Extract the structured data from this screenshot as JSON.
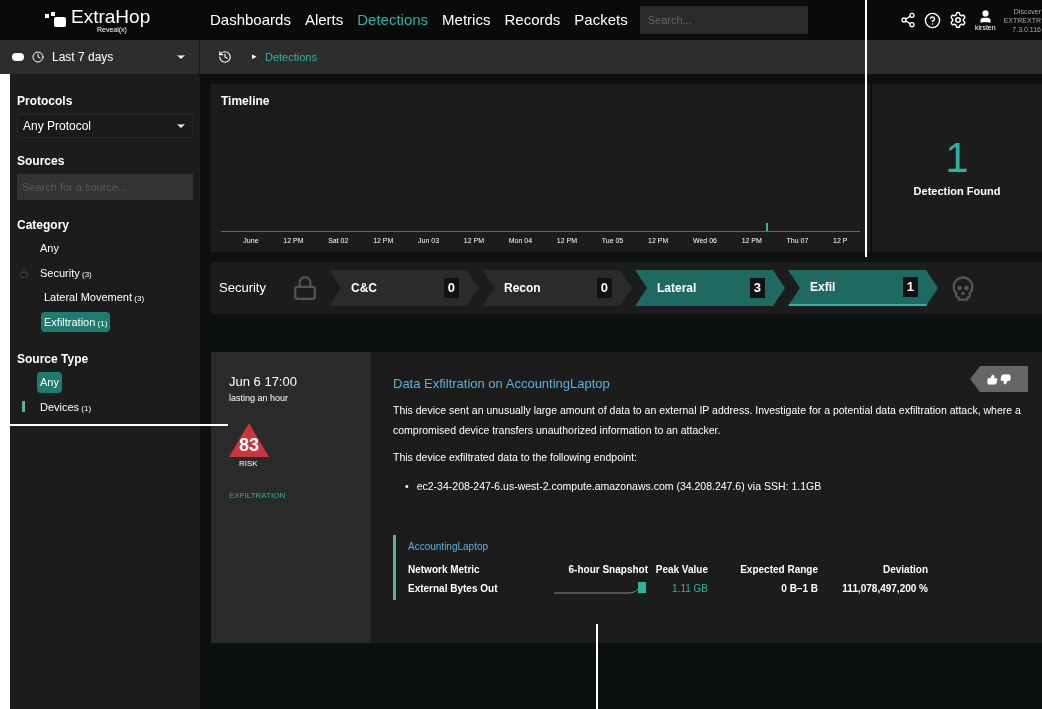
{
  "header": {
    "logo": {
      "name": "ExtraHop",
      "product": "Reveal(x)"
    },
    "nav": [
      {
        "label": "Dashboards",
        "selected": false
      },
      {
        "label": "Alerts",
        "selected": false
      },
      {
        "label": "Detections",
        "selected": true
      },
      {
        "label": "Metrics",
        "selected": false
      },
      {
        "label": "Records",
        "selected": false
      },
      {
        "label": "Packets",
        "selected": false
      }
    ],
    "search": {
      "placeholder": "Search..."
    },
    "user": "kirsten",
    "system": [
      "Discover",
      "EXTREXTR",
      "7.3.0.116"
    ]
  },
  "toolbar": {
    "time_range": "Last 7 days",
    "breadcrumb_arrow": "▸",
    "breadcrumb": "Detections"
  },
  "sidebar": {
    "protocols": {
      "title": "Protocols",
      "value": "Any Protocol"
    },
    "sources": {
      "title": "Sources",
      "placeholder": "Search for a source..."
    },
    "category": {
      "title": "Category",
      "items": [
        {
          "label": "Any",
          "selected": false
        },
        {
          "label": "Security",
          "count": "(3)",
          "selected": false,
          "children": [
            {
              "label": "Lateral Movement",
              "count": "(3)",
              "selected": false
            },
            {
              "label": "Exfiltration",
              "count": "(1)",
              "selected": true
            }
          ]
        }
      ]
    },
    "source_type": {
      "title": "Source Type",
      "items": [
        {
          "label": "Any",
          "selected": true
        },
        {
          "label": "Devices",
          "count": "(1)",
          "selected": false,
          "color": "#5fb38a"
        }
      ]
    }
  },
  "timeline": {
    "title": "Timeline",
    "xticks": [
      "June",
      "12 PM",
      "Sat 02",
      "12 PM",
      "Jun 03",
      "12 PM",
      "Mon 04",
      "12 PM",
      "Tue 05",
      "12 PM",
      "Wed 06",
      "12 PM",
      "Thu 07",
      "12 P"
    ]
  },
  "summary": {
    "count": "1",
    "label": "Detection Found"
  },
  "chain": {
    "title": "Security",
    "stages": [
      {
        "label": "C&C",
        "count": "0",
        "highlighted": false,
        "selected": false
      },
      {
        "label": "Recon",
        "count": "0",
        "highlighted": false,
        "selected": false
      },
      {
        "label": "Lateral",
        "count": "3",
        "highlighted": true,
        "selected": false
      },
      {
        "label": "Exfil",
        "count": "1",
        "highlighted": true,
        "selected": true
      }
    ]
  },
  "detection": {
    "time": "Jun 6 17:00",
    "duration": "lasting an hour",
    "risk": "83",
    "risk_label": "RISK",
    "category": "EXFILTRATION",
    "title": "Data Exfiltration on AccountingLaptop",
    "description": "This device sent an unusually large amount of data to an external IP address. Investigate for a potential data exfiltration attack, where a compromised device transfers unauthorized information to an attacker.",
    "endpoint_intro": "This device exfiltrated data to the following endpoint:",
    "bullet": "•",
    "endpoints": [
      "ec2-34-208-247-6.us-west-2.compute.amazonaws.com (34.208.247.6) via SSH: 1.1GB"
    ],
    "device": "AccountingLaptop",
    "metrics": {
      "columns": [
        "Network Metric",
        "6-hour Snapshot",
        "Peak Value",
        "Expected Range",
        "Deviation"
      ],
      "rows": [
        {
          "metric": "External Bytes Out",
          "peak": "1.11 GB",
          "range": "0 B–1 B",
          "deviation": "111,078,497,200 %"
        }
      ]
    }
  }
}
